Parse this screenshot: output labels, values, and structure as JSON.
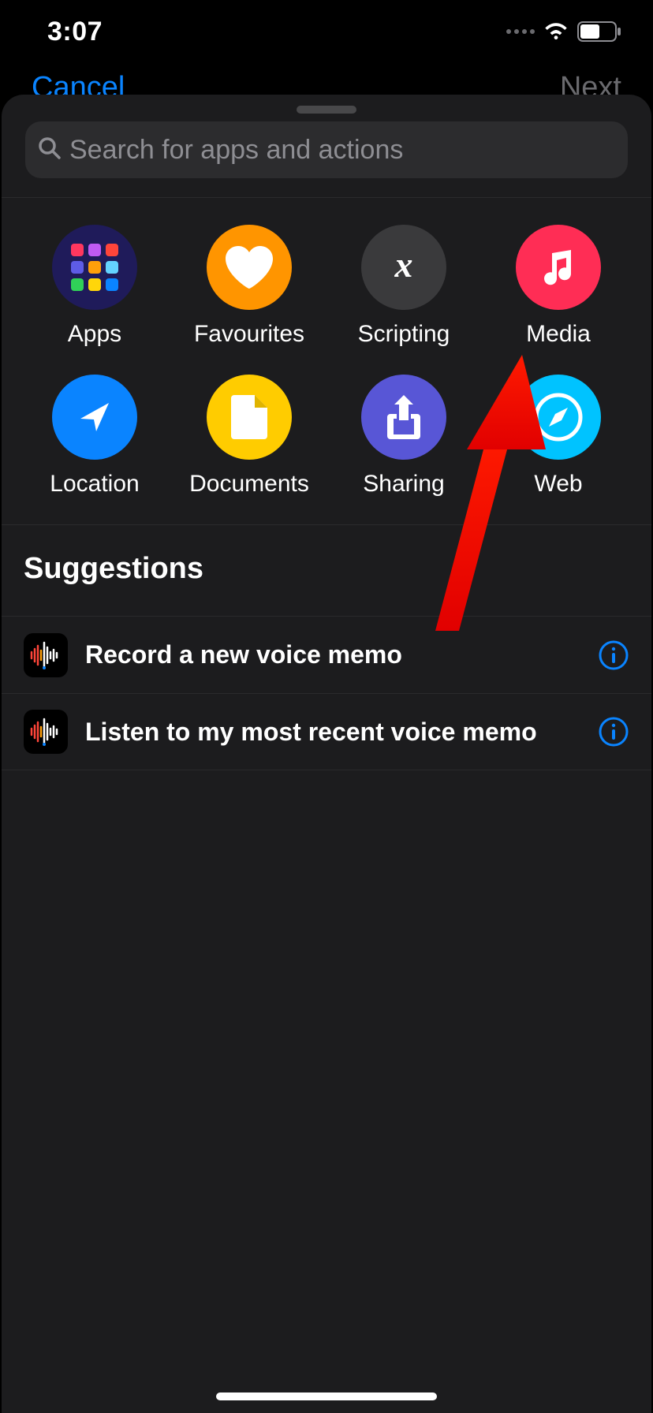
{
  "statusbar": {
    "time": "3:07"
  },
  "behind": {
    "cancel": "Cancel",
    "next": "Next"
  },
  "search": {
    "placeholder": "Search for apps and actions"
  },
  "categories": [
    {
      "id": "apps",
      "label": "Apps"
    },
    {
      "id": "fav",
      "label": "Favourites"
    },
    {
      "id": "script",
      "label": "Scripting"
    },
    {
      "id": "media",
      "label": "Media"
    },
    {
      "id": "location",
      "label": "Location"
    },
    {
      "id": "docs",
      "label": "Documents"
    },
    {
      "id": "sharing",
      "label": "Sharing"
    },
    {
      "id": "web",
      "label": "Web"
    }
  ],
  "suggestions": {
    "header": "Suggestions",
    "items": [
      {
        "label": "Record a new voice memo"
      },
      {
        "label": "Listen to my most recent voice memo"
      }
    ]
  },
  "colors": {
    "accent": "#0a84ff",
    "sheet": "#1c1c1e",
    "annotation": "#ff0000"
  }
}
